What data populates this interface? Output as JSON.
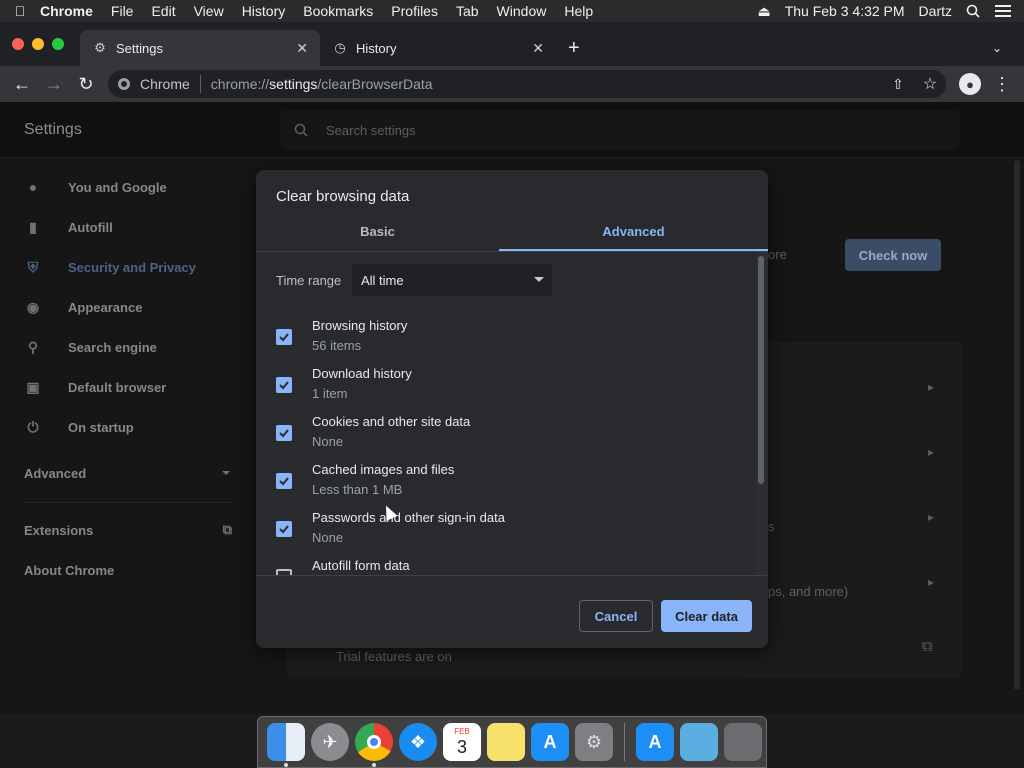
{
  "menubar": {
    "app": "Chrome",
    "items": [
      "File",
      "Edit",
      "View",
      "History",
      "Bookmarks",
      "Profiles",
      "Tab",
      "Window",
      "Help"
    ],
    "datetime": "Thu Feb 3  4:32 PM",
    "user": "Dartz"
  },
  "tabs": [
    {
      "title": "Settings",
      "icon": "gear-icon"
    },
    {
      "title": "History",
      "icon": "clock-icon"
    }
  ],
  "omnibox": {
    "chip": "Chrome",
    "url_prefix": "chrome://",
    "url_host": "settings",
    "url_path": "/clearBrowserData"
  },
  "settings": {
    "title": "Settings",
    "search_placeholder": "Search settings",
    "nav": [
      {
        "label": "You and Google",
        "icon": "person-icon"
      },
      {
        "label": "Autofill",
        "icon": "clipboard-icon"
      },
      {
        "label": "Security and Privacy",
        "icon": "shield-icon"
      },
      {
        "label": "Appearance",
        "icon": "palette-icon"
      },
      {
        "label": "Search engine",
        "icon": "search-icon"
      },
      {
        "label": "Default browser",
        "icon": "browser-icon"
      },
      {
        "label": "On startup",
        "icon": "power-icon"
      }
    ],
    "advanced": "Advanced",
    "extensions": "Extensions",
    "about": "About Chrome",
    "check_now": "Check now",
    "bg_fragments": {
      "ore": "ore",
      "s": "s",
      "more": "ps, and more)",
      "trial": "Trial features are on"
    }
  },
  "dialog": {
    "title": "Clear browsing data",
    "tab_basic": "Basic",
    "tab_advanced": "Advanced",
    "time_range_label": "Time range",
    "time_range_value": "All time",
    "options": [
      {
        "label": "Browsing history",
        "sub": "56 items",
        "checked": true
      },
      {
        "label": "Download history",
        "sub": "1 item",
        "checked": true
      },
      {
        "label": "Cookies and other site data",
        "sub": "None",
        "checked": true
      },
      {
        "label": "Cached images and files",
        "sub": "Less than 1 MB",
        "checked": true
      },
      {
        "label": "Passwords and other sign-in data",
        "sub": "None",
        "checked": true
      },
      {
        "label": "Autofill form data",
        "sub": "",
        "checked": false
      }
    ],
    "cancel": "Cancel",
    "clear": "Clear data"
  },
  "dock": {
    "calendar_month": "FEB",
    "calendar_day": "3"
  },
  "colors": {
    "accent": "#8ab4f8",
    "dialog_bg": "#292a2d"
  }
}
